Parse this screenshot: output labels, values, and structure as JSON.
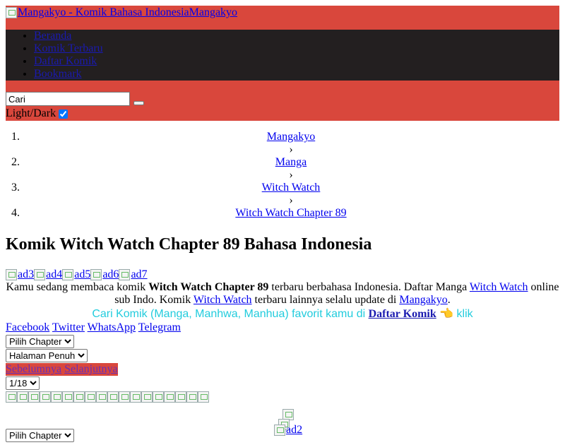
{
  "header": {
    "logo_alt": "Mangakyo - Komik Bahasa Indonesia",
    "site_name": "Mangakyo"
  },
  "nav": {
    "items": [
      "Beranda",
      "Komik Terbaru",
      "Daftar Komik",
      "Bookmark"
    ]
  },
  "search": {
    "value": "Cari"
  },
  "theme": {
    "label": "Light/Dark",
    "checked": true
  },
  "breadcrumb": {
    "items": [
      "Mangakyo",
      "Manga",
      "Witch Watch",
      "Witch Watch Chapter 89"
    ],
    "separator": "›"
  },
  "title": "Komik Witch Watch Chapter 89 Bahasa Indonesia",
  "ads": [
    "ad3",
    "ad4",
    "ad5",
    "ad6",
    "ad7"
  ],
  "intro": {
    "p1": "Kamu sedang membaca komik ",
    "bold": "Witch Watch Chapter 89",
    "p2": " terbaru berbahasa Indonesia. Daftar Manga ",
    "link1": "Witch Watch",
    "p3": " online sub Indo. Komik ",
    "link2": "Witch Watch",
    "p4": " terbaru lainnya selalu update di ",
    "link3": "Mangakyo",
    "p5": "."
  },
  "cta": {
    "text": "Cari Komik (Manga, Manhwa, Manhua) favorit kamu di ",
    "link": "Daftar Komik",
    "emoji": "👈",
    "suffix": " klik"
  },
  "share": [
    "Facebook",
    "Twitter",
    "WhatsApp",
    "Telegram"
  ],
  "selects": {
    "chapter": "Pilih Chapter",
    "view_mode": "Halaman Penuh",
    "page": "1/18",
    "chapter_bottom": "Pilih Chapter"
  },
  "nav_buttons": {
    "prev": "Sebelumnya",
    "next": "Selanjutnya"
  },
  "bottom_ad": "ad2",
  "colors": {
    "header_red": "#d9473c",
    "nav_dark": "#231f20",
    "cta_cyan": "#22ccdd"
  }
}
